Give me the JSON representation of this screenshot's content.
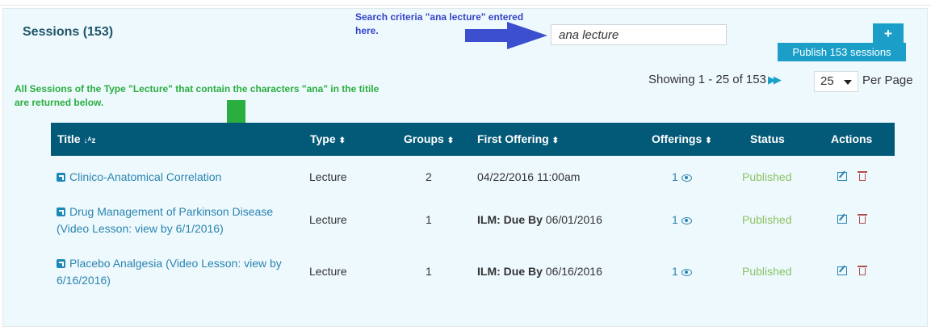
{
  "header": {
    "title": "Sessions (153)"
  },
  "annotations": {
    "search_note": "Search criteria \"ana lecture\" entered here.",
    "results_note": "All Sessions of the Type \"Lecture\" that contain the characters \"ana\" in the titile are returned below.",
    "arrow_blue_color": "#3b4fcf",
    "arrow_green_color": "#2aae3f"
  },
  "search": {
    "value": "ana lecture",
    "placeholder": ""
  },
  "toolbar": {
    "add_label": "+",
    "publish_label": "Publish 153 sessions"
  },
  "pagination": {
    "showing": "Showing 1 - 25 of 153",
    "per_page_value": "25",
    "per_page_label": "Per Page"
  },
  "table": {
    "columns": {
      "title": "Title",
      "type": "Type",
      "groups": "Groups",
      "first_offering": "First Offering",
      "offerings": "Offerings",
      "status": "Status",
      "actions": "Actions"
    },
    "rows": [
      {
        "title": "Clinico-Anatomical Correlation",
        "type": "Lecture",
        "groups": "2",
        "first_offering_prefix": "",
        "first_offering": "04/22/2016 11:00am",
        "offerings": "1",
        "status": "Published"
      },
      {
        "title": "Drug Management of Parkinson Disease (Video Lesson: view by 6/1/2016)",
        "type": "Lecture",
        "groups": "1",
        "first_offering_prefix": "ILM: Due By",
        "first_offering": "06/01/2016",
        "offerings": "1",
        "status": "Published"
      },
      {
        "title": "Placebo Analgesia (Video Lesson: view by 6/16/2016)",
        "type": "Lecture",
        "groups": "1",
        "first_offering_prefix": "ILM: Due By",
        "first_offering": "06/16/2016",
        "offerings": "1",
        "status": "Published"
      }
    ]
  },
  "colors": {
    "header_bg": "#035978",
    "accent": "#1b9fc9",
    "published": "#8bc262",
    "link": "#2a84ae"
  }
}
